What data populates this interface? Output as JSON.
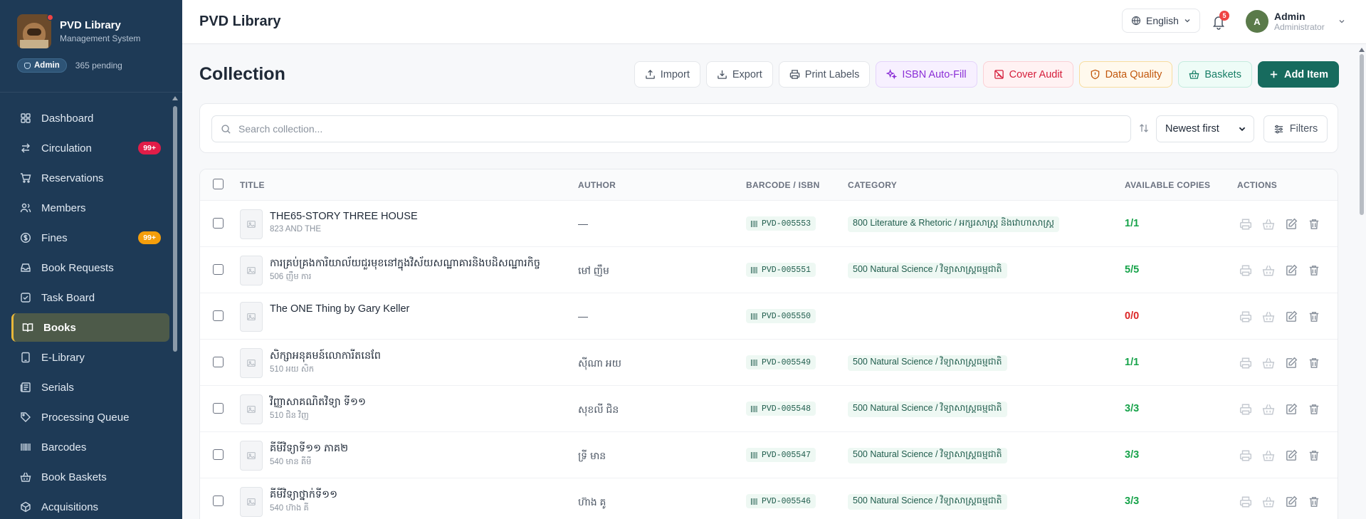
{
  "brand": {
    "name": "PVD Library",
    "subtitle": "Management System",
    "role": "Admin",
    "pending": "365 pending"
  },
  "sidebar": {
    "items": [
      {
        "label": "Dashboard",
        "icon": "grid-icon",
        "badge": ""
      },
      {
        "label": "Circulation",
        "icon": "arrows-icon",
        "badge": "99+",
        "badge_color": "red"
      },
      {
        "label": "Reservations",
        "icon": "cart-icon",
        "badge": ""
      },
      {
        "label": "Members",
        "icon": "users-icon",
        "badge": ""
      },
      {
        "label": "Fines",
        "icon": "dollar-icon",
        "badge": "99+",
        "badge_color": "orange"
      },
      {
        "label": "Book Requests",
        "icon": "inbox-icon",
        "badge": ""
      },
      {
        "label": "Task Board",
        "icon": "check-square-icon",
        "badge": ""
      },
      {
        "label": "Books",
        "icon": "book-open-icon",
        "badge": "",
        "active": true
      },
      {
        "label": "E-Library",
        "icon": "tablet-icon",
        "badge": ""
      },
      {
        "label": "Serials",
        "icon": "newspaper-icon",
        "badge": ""
      },
      {
        "label": "Processing Queue",
        "icon": "tag-icon",
        "badge": ""
      },
      {
        "label": "Barcodes",
        "icon": "barcode-icon",
        "badge": ""
      },
      {
        "label": "Book Baskets",
        "icon": "basket-icon",
        "badge": ""
      },
      {
        "label": "Acquisitions",
        "icon": "package-icon",
        "badge": ""
      }
    ]
  },
  "header": {
    "title": "PVD Library",
    "language": "English",
    "notifications": "5",
    "user": {
      "initial": "A",
      "name": "Admin",
      "role": "Administrator"
    }
  },
  "page": {
    "title": "Collection",
    "toolbar": {
      "import": "Import",
      "export": "Export",
      "print_labels": "Print Labels",
      "isbn": "ISBN Auto-Fill",
      "cover_audit": "Cover Audit",
      "data_quality": "Data Quality",
      "baskets": "Baskets",
      "add_item": "Add Item"
    },
    "search": {
      "placeholder": "Search collection..."
    },
    "sort": "Newest first",
    "filters": "Filters"
  },
  "table": {
    "headers": {
      "title": "TITLE",
      "author": "AUTHOR",
      "barcode": "BARCODE / ISBN",
      "category": "CATEGORY",
      "copies": "AVAILABLE COPIES",
      "actions": "ACTIONS"
    },
    "rows": [
      {
        "title": "THE65-STORY THREE HOUSE",
        "subtitle": "823 AND THE",
        "author": "—",
        "barcode": "PVD-005553",
        "category": "800 Literature & Rhetoric / អក្សរសាស្ត្រ និងវោហាសាស្ត្រ",
        "copies": "1/1",
        "status": "ok"
      },
      {
        "title": "ការគ្រប់គ្រងការិយាល័យជួរមុខនៅក្នុងវិស័យសណ្ឋាគារនិងបដិសណ្ឋារកិច្ច",
        "subtitle": "506 ញឹម ការ",
        "author": "មៅ ញឹម",
        "barcode": "PVD-005551",
        "category": "500 Natural Science / វិទ្យាសាស្ត្រធម្មជាតិ",
        "copies": "5/5",
        "status": "ok"
      },
      {
        "title": "The ONE Thing by Gary Keller",
        "subtitle": "",
        "author": "—",
        "barcode": "PVD-005550",
        "category": "",
        "copies": "0/0",
        "status": "zero"
      },
      {
        "title": "សិក្សាអនុគមន៍លោការីតនេពែ",
        "subtitle": "510 អយ សិក",
        "author": "ស៊ីណា អយ",
        "barcode": "PVD-005549",
        "category": "500 Natural Science / វិទ្យាសាស្ត្រធម្មជាតិ",
        "copies": "1/1",
        "status": "ok"
      },
      {
        "title": "វិញ្ញាសាគណិតវិទ្យា ទី១១",
        "subtitle": "510 ជិន វិញ",
        "author": "សុខលី ជិន",
        "barcode": "PVD-005548",
        "category": "500 Natural Science / វិទ្យាសាស្ត្រធម្មជាតិ",
        "copies": "3/3",
        "status": "ok"
      },
      {
        "title": "គីមីវិទ្យាទី១១ ភាគ២",
        "subtitle": "540 មាន គីមី",
        "author": "ទ្រី មាន",
        "barcode": "PVD-005547",
        "category": "500 Natural Science / វិទ្យាសាស្ត្រធម្មជាតិ",
        "copies": "3/3",
        "status": "ok"
      },
      {
        "title": "គីមីវិទ្យាថ្នាក់ទី១១",
        "subtitle": "540 ហ៊ាង គី",
        "author": "ហ៊ាង គូ",
        "barcode": "PVD-005546",
        "category": "500 Natural Science / វិទ្យាសាស្ត្រធម្មជាតិ",
        "copies": "3/3",
        "status": "ok"
      }
    ]
  },
  "colors": {
    "sidebar": "#1e3a56",
    "accent": "#176b5e",
    "available": "#17a34a",
    "unavailable": "#dc2626"
  }
}
